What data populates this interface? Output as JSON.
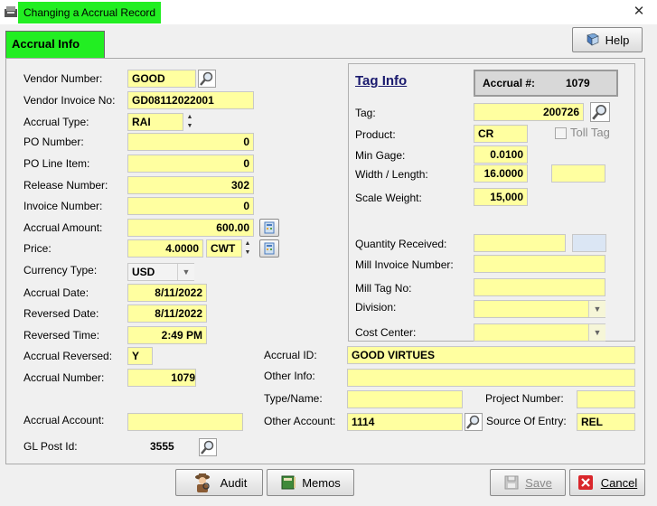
{
  "window": {
    "title": "Changing a Accrual Record"
  },
  "tab": {
    "label": "Accrual Info"
  },
  "help_label": "Help",
  "left": {
    "vendor_number": {
      "label": "Vendor Number:",
      "value": "GOOD"
    },
    "vendor_invoice": {
      "label": "Vendor Invoice No:",
      "value": "GD08112022001"
    },
    "accrual_type": {
      "label": "Accrual Type:",
      "value": "RAI"
    },
    "po_number": {
      "label": "PO Number:",
      "value": "0"
    },
    "po_line_item": {
      "label": "PO Line Item:",
      "value": "0"
    },
    "release_number": {
      "label": "Release Number:",
      "value": "302"
    },
    "invoice_number": {
      "label": "Invoice Number:",
      "value": "0"
    },
    "accrual_amount": {
      "label": "Accrual Amount:",
      "value": "600.00"
    },
    "price": {
      "label": "Price:",
      "value": "4.0000",
      "unit": "CWT"
    },
    "currency_type": {
      "label": "Currency Type:",
      "value": "USD"
    },
    "accrual_date": {
      "label": "Accrual Date:",
      "value": "8/11/2022"
    },
    "reversed_date": {
      "label": "Reversed Date:",
      "value": "8/11/2022"
    },
    "reversed_time": {
      "label": "Reversed Time:",
      "value": "2:49 PM"
    },
    "accrual_reversed": {
      "label": "Accrual Reversed:",
      "value": "Y"
    },
    "accrual_number": {
      "label": "Accrual Number:",
      "value": "1079"
    },
    "accrual_account": {
      "label": "Accrual Account:",
      "value": ""
    },
    "gl_post_id": {
      "label": "GL Post Id:",
      "value": "3555"
    }
  },
  "tag_info": {
    "title": "Tag Info",
    "accrual_no_label": "Accrual #:",
    "accrual_no_value": "1079",
    "tag": {
      "label": "Tag:",
      "value": "200726"
    },
    "product": {
      "label": "Product:",
      "value": "CR"
    },
    "toll_tag_label": "Toll Tag",
    "min_gage": {
      "label": "Min Gage:",
      "value": "0.0100"
    },
    "width_length": {
      "label": "Width / Length:",
      "value": "16.0000",
      "value2": ""
    },
    "scale_weight": {
      "label": "Scale Weight:",
      "value": "15,000"
    },
    "quantity_received": {
      "label": "Quantity Received:",
      "value": ""
    },
    "mill_invoice": {
      "label": "Mill Invoice Number:",
      "value": ""
    },
    "mill_tag": {
      "label": "Mill Tag No:",
      "value": ""
    },
    "division": {
      "label": "Division:",
      "value": ""
    },
    "cost_center": {
      "label": "Cost Center:",
      "value": ""
    }
  },
  "bottom": {
    "accrual_id": {
      "label": "Accrual ID:",
      "value": "GOOD VIRTUES"
    },
    "other_info": {
      "label": "Other Info:",
      "value": ""
    },
    "type_name": {
      "label": "Type/Name:",
      "value": ""
    },
    "project_number": {
      "label": "Project Number:",
      "value": ""
    },
    "other_account": {
      "label": "Other Account:",
      "value": "1114"
    },
    "source_of_entry": {
      "label": "Source Of Entry:",
      "value": "REL"
    }
  },
  "buttons": {
    "audit": "Audit",
    "memos": "Memos",
    "save": "Save",
    "cancel": "Cancel"
  },
  "colors": {
    "field": "#ffffa0",
    "highlight": "#22ee22"
  }
}
